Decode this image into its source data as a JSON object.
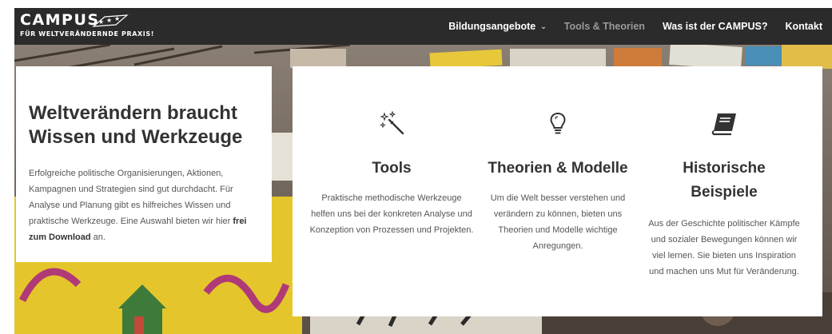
{
  "header": {
    "logo_main": "CAMPUS",
    "logo_sub": "FÜR WELTVERÄNDERNDE PRAXIS!",
    "nav": [
      {
        "label": "Bildungsangebote",
        "has_dropdown": true,
        "active": false
      },
      {
        "label": "Tools & Theorien",
        "has_dropdown": false,
        "active": true
      },
      {
        "label": "Was ist der CAMPUS?",
        "has_dropdown": false,
        "active": false
      },
      {
        "label": "Kontakt",
        "has_dropdown": false,
        "active": false
      }
    ]
  },
  "intro": {
    "title_line1": "Weltverändern braucht",
    "title_line2": "Wissen und Werkzeuge",
    "text_before": "Erfolgreiche politische Organisierungen, Aktionen, Kampagnen und Strategien sind gut durchdacht. Für Analyse und Planung gibt es hilfreiches Wissen und praktische Werkzeuge. Eine Auswahl bieten wir hier",
    "link_text": "frei zum Download",
    "text_after": "an."
  },
  "features": [
    {
      "icon": "magic-wand-icon",
      "title": "Tools",
      "text": "Praktische methodische Werkzeuge helfen uns bei der konkreten Analyse und Konzeption von Prozessen und Projekten."
    },
    {
      "icon": "lightbulb-icon",
      "title": "Theorien & Modelle",
      "text": "Um die Welt besser verstehen und verändern zu können, bieten uns Theorien und Modelle wichtige Anregungen."
    },
    {
      "icon": "book-icon",
      "title_line1": "Historische",
      "title_line2": "Beispiele",
      "text": "Aus der Geschichte politischer Kämpfe und sozialer Bewegungen können wir viel lernen. Sie bieten uns Inspiration und machen uns Mut für Veränderung."
    }
  ],
  "colors": {
    "header_bg": "#2b2b2b",
    "nav_active": "#9a9a9a",
    "heading": "#333333",
    "body_text": "#555555"
  }
}
